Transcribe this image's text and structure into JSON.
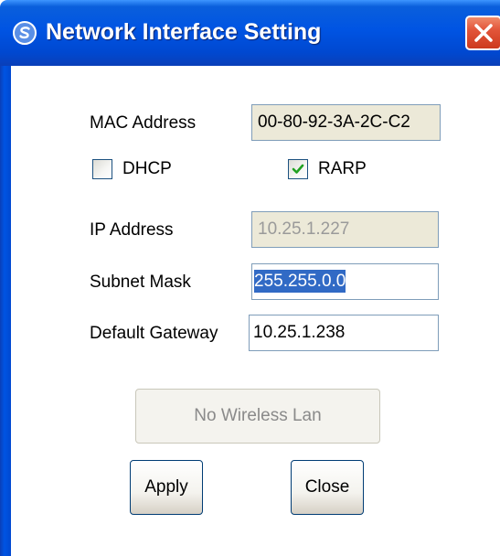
{
  "window": {
    "title": "Network Interface Setting",
    "title_icon": "app-logo-icon",
    "close_icon": "close-icon",
    "title_bar_color": "#0054e3",
    "close_button_color": "#e2553a"
  },
  "form": {
    "mac_label": "MAC Address",
    "mac_value": "00-80-92-3A-2C-C2",
    "dhcp_label": "DHCP",
    "dhcp_checked": false,
    "rarp_label": "RARP",
    "rarp_checked": true,
    "ip_label": "IP Address",
    "ip_value": "10.25.1.227",
    "subnet_label": "Subnet Mask",
    "subnet_value": "255.255.0.0",
    "gateway_label": "Default Gateway",
    "gateway_value": "10.25.1.238"
  },
  "buttons": {
    "wireless_label": "No Wireless Lan",
    "apply_label": "Apply",
    "close_label": "Close"
  }
}
